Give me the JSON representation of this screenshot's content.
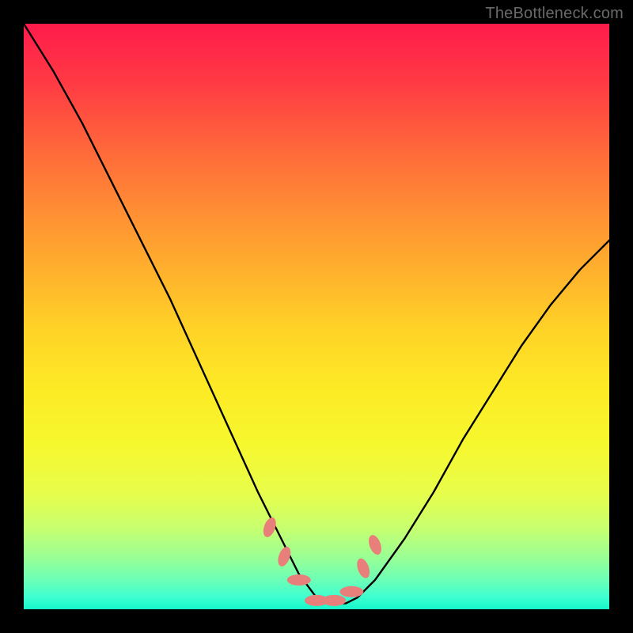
{
  "watermark": "TheBottleneck.com",
  "chart_data": {
    "type": "line",
    "title": "",
    "xlabel": "",
    "ylabel": "",
    "xlim": [
      0,
      100
    ],
    "ylim": [
      0,
      100
    ],
    "grid": false,
    "legend": false,
    "series": [
      {
        "name": "bottleneck-curve",
        "x": [
          0,
          5,
          10,
          15,
          20,
          25,
          30,
          35,
          40,
          45,
          47,
          50,
          53,
          55,
          57,
          60,
          65,
          70,
          75,
          80,
          85,
          90,
          95,
          100
        ],
        "y": [
          100,
          92,
          83,
          73,
          63,
          53,
          42,
          31,
          20,
          10,
          6,
          2,
          1,
          1,
          2,
          5,
          12,
          20,
          29,
          37,
          45,
          52,
          58,
          63
        ]
      }
    ],
    "markers": {
      "name": "highlight-points",
      "shape": "pill",
      "color": "#e97f7a",
      "x": [
        42,
        44.5,
        47,
        50,
        53,
        56,
        58,
        60
      ],
      "y": [
        14,
        9,
        5,
        1.5,
        1.5,
        3,
        7,
        11
      ]
    },
    "background_gradient": {
      "top": "#ff1b4b",
      "mid": "#ffd227",
      "bottom": "#15f7c9"
    }
  }
}
